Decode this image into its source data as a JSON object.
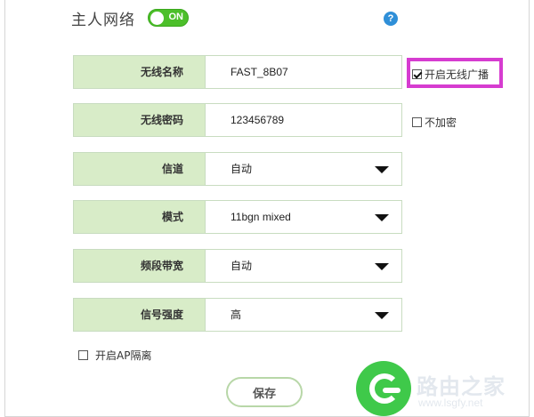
{
  "header": {
    "title": "主人网络",
    "toggle_label": "ON",
    "toggle_state": "on",
    "help_glyph": "?"
  },
  "fields": [
    {
      "label": "无线名称",
      "value": "FAST_8B07",
      "type": "text"
    },
    {
      "label": "无线密码",
      "value": "123456789",
      "type": "text"
    },
    {
      "label": "信道",
      "value": "自动",
      "type": "select"
    },
    {
      "label": "模式",
      "value": "11bgn mixed",
      "type": "select"
    },
    {
      "label": "频段带宽",
      "value": "自动",
      "type": "select"
    },
    {
      "label": "信号强度",
      "value": "高",
      "type": "select"
    }
  ],
  "options": {
    "broadcast": {
      "label": "开启无线广播",
      "checked": true
    },
    "no_encrypt": {
      "label": "不加密",
      "checked": false
    },
    "ap_isolation": {
      "label": "开启AP隔离",
      "checked": false
    }
  },
  "save_label": "保存",
  "watermark": {
    "text": "路由之家",
    "url": "www.lsgfy.net"
  },
  "colors": {
    "accent_green": "#4cbf2a",
    "label_bg": "#d8ecc8",
    "highlight": "#d63cd0",
    "help_blue": "#2f8fd8"
  }
}
